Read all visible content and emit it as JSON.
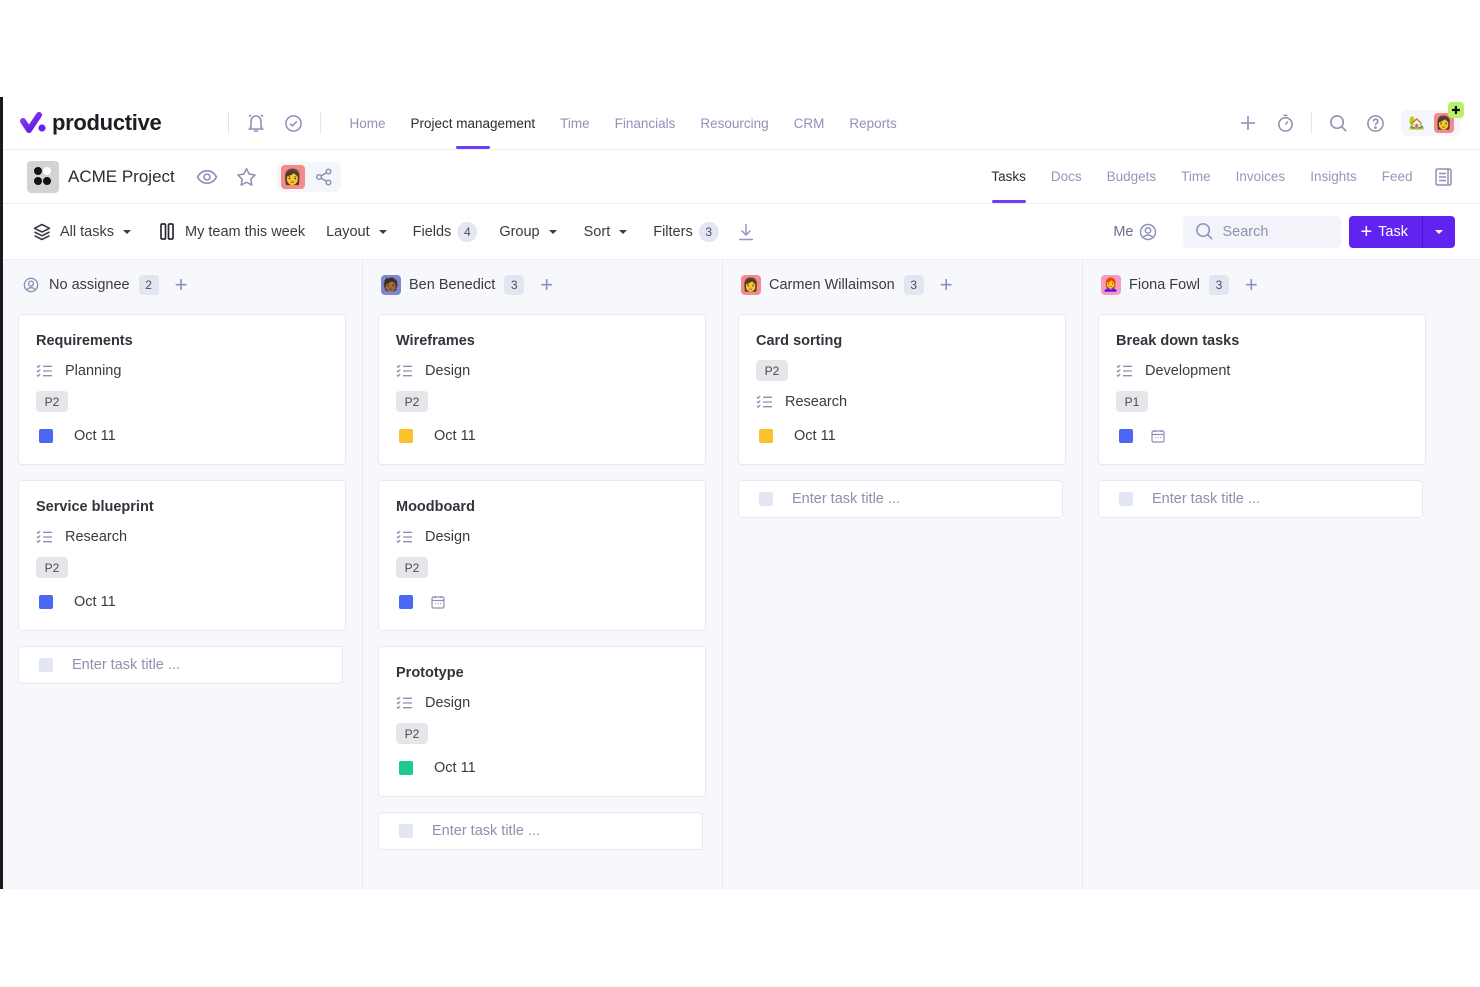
{
  "brand": {
    "name": "productive",
    "accent": "#6e3cf5"
  },
  "topnav": {
    "items": [
      {
        "label": "Home",
        "active": false
      },
      {
        "label": "Project management",
        "active": true
      },
      {
        "label": "Time",
        "active": false
      },
      {
        "label": "Financials",
        "active": false
      },
      {
        "label": "Resourcing",
        "active": false
      },
      {
        "label": "CRM",
        "active": false
      },
      {
        "label": "Reports",
        "active": false
      }
    ],
    "left_icons": [
      "bell-icon",
      "check-circle-icon"
    ],
    "right_icons": [
      "plus-icon",
      "timer-icon",
      "search-icon",
      "help-icon"
    ],
    "badge_plus": "✚"
  },
  "project": {
    "title": "ACME Project",
    "tabs": [
      {
        "label": "Tasks",
        "active": true
      },
      {
        "label": "Docs",
        "active": false
      },
      {
        "label": "Budgets",
        "active": false
      },
      {
        "label": "Time",
        "active": false
      },
      {
        "label": "Invoices",
        "active": false
      },
      {
        "label": "Insights",
        "active": false
      },
      {
        "label": "Feed",
        "active": false
      }
    ]
  },
  "toolbar": {
    "all_tasks": "All tasks",
    "view_name": "My team this week",
    "layout": "Layout",
    "fields": "Fields",
    "fields_count": "4",
    "group": "Group",
    "sort": "Sort",
    "filters": "Filters",
    "filters_count": "3",
    "me": "Me",
    "search_placeholder": "Search",
    "task_button": "Task",
    "task_button_color": "#6123f0"
  },
  "colors": {
    "status_blue": "#4b68f5",
    "status_yellow": "#fbc02d",
    "status_green": "#1ec98a"
  },
  "columns": [
    {
      "name": "No assignee",
      "count": "2",
      "avatar": "none",
      "cards": [
        {
          "title": "Requirements",
          "rows": [
            {
              "type": "list",
              "label": "Planning"
            },
            {
              "type": "prio",
              "label": "P2"
            },
            {
              "type": "date",
              "status": "blue",
              "label": "Oct 11"
            }
          ]
        },
        {
          "title": "Service blueprint",
          "rows": [
            {
              "type": "list",
              "label": "Research"
            },
            {
              "type": "prio",
              "label": "P2"
            },
            {
              "type": "date",
              "status": "blue",
              "label": "Oct 11"
            }
          ]
        }
      ],
      "new_task_placeholder": "Enter task title ..."
    },
    {
      "name": "Ben Benedict",
      "count": "3",
      "avatar": "ben",
      "cards": [
        {
          "title": "Wireframes",
          "rows": [
            {
              "type": "list",
              "label": "Design"
            },
            {
              "type": "prio",
              "label": "P2"
            },
            {
              "type": "date",
              "status": "yellow",
              "label": "Oct 11"
            }
          ]
        },
        {
          "title": "Moodboard",
          "rows": [
            {
              "type": "list",
              "label": "Design"
            },
            {
              "type": "prio",
              "label": "P2"
            },
            {
              "type": "date",
              "status": "blue",
              "label": ""
            }
          ]
        },
        {
          "title": "Prototype",
          "rows": [
            {
              "type": "list",
              "label": "Design"
            },
            {
              "type": "prio",
              "label": "P2"
            },
            {
              "type": "date",
              "status": "green",
              "label": "Oct 11"
            }
          ]
        }
      ],
      "new_task_placeholder": "Enter task title ..."
    },
    {
      "name": "Carmen Willaimson",
      "count": "3",
      "avatar": "carmen",
      "cards": [
        {
          "title": "Card sorting",
          "rows": [
            {
              "type": "prio",
              "label": "P2"
            },
            {
              "type": "list",
              "label": "Research"
            },
            {
              "type": "date",
              "status": "yellow",
              "label": "Oct 11"
            }
          ]
        }
      ],
      "new_task_placeholder": "Enter task title ..."
    },
    {
      "name": "Fiona Fowl",
      "count": "3",
      "avatar": "fiona",
      "cards": [
        {
          "title": "Break down tasks",
          "rows": [
            {
              "type": "list",
              "label": "Development"
            },
            {
              "type": "prio",
              "label": "P1"
            },
            {
              "type": "date",
              "status": "blue",
              "label": ""
            }
          ]
        }
      ],
      "new_task_placeholder": "Enter task title ..."
    }
  ]
}
